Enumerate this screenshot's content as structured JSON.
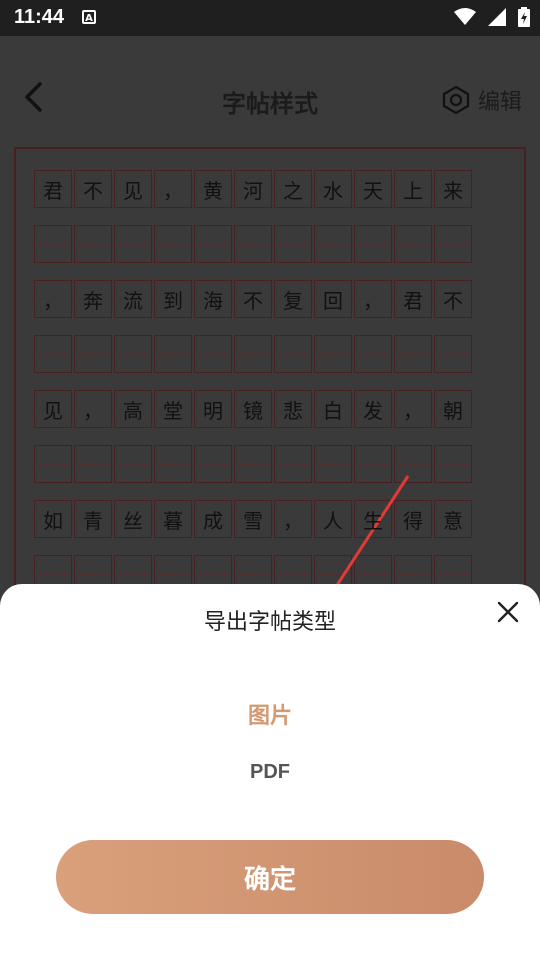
{
  "status": {
    "time": "11:44",
    "a_icon": "A"
  },
  "appbar": {
    "title": "字帖样式",
    "edit_label": "编辑"
  },
  "grid": {
    "rows": [
      [
        "君",
        "不",
        "见",
        "，",
        "黄",
        "河",
        "之",
        "水",
        "天",
        "上",
        "来"
      ],
      [
        "",
        "",
        "",
        "",
        "",
        "",
        "",
        "",
        "",
        "",
        ""
      ],
      [
        "，",
        "奔",
        "流",
        "到",
        "海",
        "不",
        "复",
        "回",
        "，",
        "君",
        "不"
      ],
      [
        "",
        "",
        "",
        "",
        "",
        "",
        "",
        "",
        "",
        "",
        ""
      ],
      [
        "见",
        "，",
        "高",
        "堂",
        "明",
        "镜",
        "悲",
        "白",
        "发",
        "，",
        "朝"
      ],
      [
        "",
        "",
        "",
        "",
        "",
        "",
        "",
        "",
        "",
        "",
        ""
      ],
      [
        "如",
        "青",
        "丝",
        "暮",
        "成",
        "雪",
        "，",
        "人",
        "生",
        "得",
        "意"
      ],
      [
        "",
        "",
        "",
        "",
        "",
        "",
        "",
        "",
        "",
        "",
        ""
      ]
    ]
  },
  "dialog": {
    "title": "导出字帖类型",
    "option_image": "图片",
    "option_pdf": "PDF",
    "confirm": "确定"
  },
  "colors": {
    "accent": "#d39a72",
    "annotation_arrow": "#e53935"
  }
}
